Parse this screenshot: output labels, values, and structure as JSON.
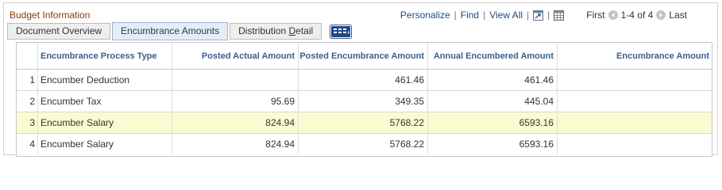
{
  "title": "Budget Information",
  "nav": {
    "personalize": "Personalize",
    "find": "Find",
    "view_all": "View All",
    "first": "First",
    "range": "1-4 of 4",
    "last": "Last"
  },
  "tabs": [
    {
      "label": "Document Overview",
      "active": false
    },
    {
      "label": "Encumbrance Amounts",
      "active": true
    },
    {
      "label_pre": "Distribution ",
      "label_ul": "D",
      "label_post": "etail",
      "active": false
    }
  ],
  "columns": [
    "",
    "Encumbrance Process Type",
    "Posted Actual Amount",
    "Posted Encumbrance Amount",
    "Annual Encumbered Amount",
    "Encumbrance Amount"
  ],
  "rows": [
    {
      "num": "1",
      "type": "Encumber Deduction",
      "actual": "",
      "posted_enc": "461.46",
      "annual": "461.46",
      "enc": "",
      "highlight": false
    },
    {
      "num": "2",
      "type": "Encumber Tax",
      "actual": "95.69",
      "posted_enc": "349.35",
      "annual": "445.04",
      "enc": "",
      "highlight": false
    },
    {
      "num": "3",
      "type": "Encumber Salary",
      "actual": "824.94",
      "posted_enc": "5768.22",
      "annual": "6593.16",
      "enc": "",
      "highlight": true
    },
    {
      "num": "4",
      "type": "Encumber Salary",
      "actual": "824.94",
      "posted_enc": "5768.22",
      "annual": "6593.16",
      "enc": "",
      "highlight": false
    }
  ],
  "icons": {
    "zoom": "zoom-grid-icon",
    "download": "download-spreadsheet-icon",
    "prev": "previous-arrow-icon",
    "next": "next-arrow-icon",
    "show_all_columns": "show-all-columns-icon"
  },
  "colors": {
    "title": "#8b3a0e",
    "link": "#1e4b7c",
    "header_text": "#3a5f8a",
    "highlight_row": "#fbfbd2",
    "active_tab": "#e3edf7"
  }
}
